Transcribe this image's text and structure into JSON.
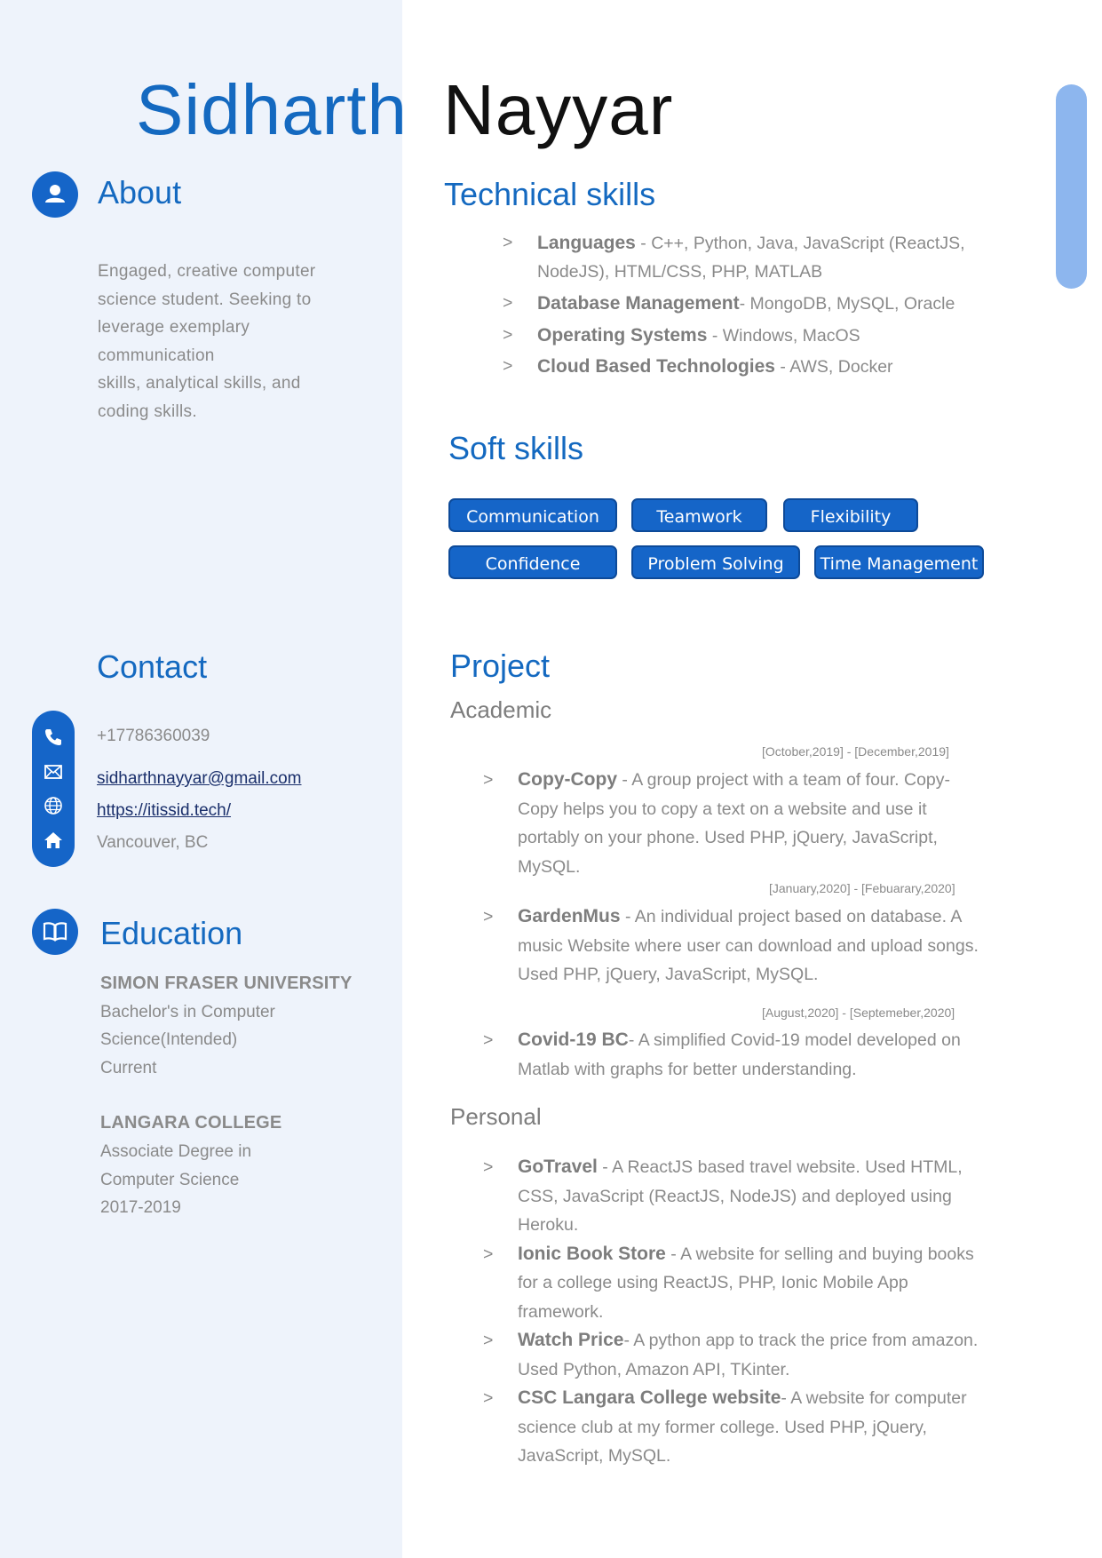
{
  "name": {
    "first": "Sidharth",
    "last": "Nayyar"
  },
  "colors": {
    "accent": "#1469c0",
    "left_background": "#eef3fb",
    "chip": "#1565c8",
    "scrollbar": "#8db6ee"
  },
  "about": {
    "heading": "About",
    "icon": "user-icon",
    "lines": [
      "Engaged, creative computer",
      "science student. Seeking to",
      "leverage exemplary",
      "communication",
      "skills, analytical skills, and",
      "coding skills."
    ]
  },
  "contact": {
    "heading": "Contact",
    "phone": "+17786360039",
    "email": "sidharthnayyar@gmail.com",
    "website": "https://itissid.tech/",
    "location": "Vancouver, BC",
    "icons": [
      "phone-icon",
      "mail-icon",
      "globe-icon",
      "home-icon"
    ]
  },
  "education": {
    "heading": "Education",
    "icon": "book-icon",
    "entries": [
      {
        "school": "SIMON FRASER UNIVERSITY",
        "lines": [
          "Bachelor's in Computer",
          "Science(Intended)",
          "Current"
        ]
      },
      {
        "school": "LANGARA COLLEGE",
        "lines": [
          "Associate Degree in",
          "Computer Science",
          "2017-2019"
        ]
      }
    ]
  },
  "technical": {
    "heading": "Technical skills",
    "items": [
      {
        "key": "Languages",
        "text": " - C++, Python, Java, JavaScript (ReactJS, NodeJS), HTML/CSS, PHP, MATLAB"
      },
      {
        "key": "Database Management",
        "text": "- MongoDB, MySQL, Oracle"
      },
      {
        "key": "Operating Systems",
        "text": " - Windows, MacOS"
      },
      {
        "key": "Cloud Based Technologies",
        "text": " - AWS, Docker"
      }
    ]
  },
  "soft": {
    "heading": "Soft skills",
    "chips": [
      "Communication",
      "Teamwork",
      "Flexibility",
      "Confidence",
      "Problem Solving",
      "Time Management"
    ]
  },
  "project": {
    "heading": "Project",
    "academic_heading": "Academic",
    "personal_heading": "Personal",
    "academic": [
      {
        "date": "[October,2019] - [December,2019]",
        "key": "Copy-Copy",
        "text": " - A group project with a team of four. Copy-Copy helps you to copy a text on a website and use it portably on your phone. Used PHP, jQuery, JavaScript, MySQL."
      },
      {
        "date": "[January,2020] - [Febuarary,2020]",
        "key": "GardenMus",
        "text": " - An individual project based on database. A music Website where user can download and upload songs. Used PHP, jQuery, JavaScript, MySQL."
      },
      {
        "date": "[August,2020] - [Septemeber,2020]",
        "key": "Covid-19 BC",
        "text": "- A simplified Covid-19 model developed on Matlab with graphs for better understanding."
      }
    ],
    "personal": [
      {
        "key": "GoTravel",
        "text": " - A ReactJS based travel website. Used HTML, CSS, JavaScript (ReactJS, NodeJS) and deployed using Heroku."
      },
      {
        "key": "Ionic Book Store",
        "text": " - A website for selling and buying books for a college using ReactJS, PHP, Ionic Mobile App framework."
      },
      {
        "key": "Watch Price",
        "text": "- A python app to track the price from amazon. Used Python, Amazon API, TKinter."
      },
      {
        "key": "CSC Langara College website",
        "text": "- A website for computer science club at my former college. Used PHP, jQuery, JavaScript, MySQL."
      }
    ]
  }
}
